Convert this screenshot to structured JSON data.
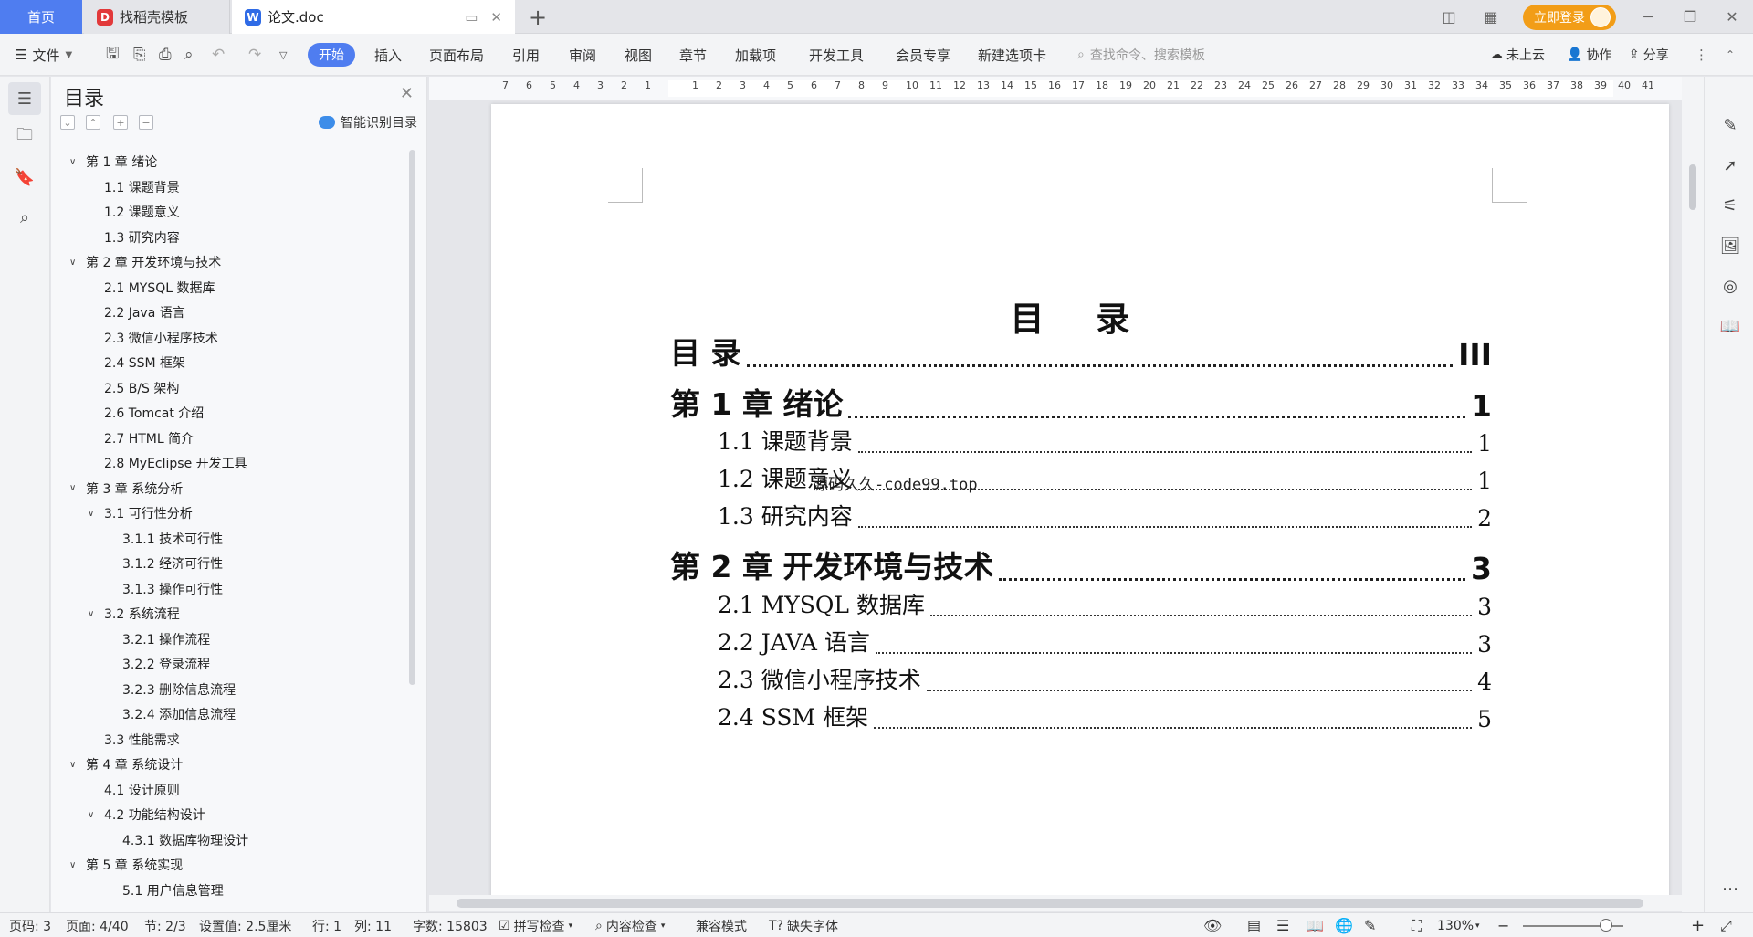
{
  "tabs": {
    "home": "首页",
    "template": "找稻壳模板",
    "doc": "论文.doc"
  },
  "window": {
    "login": "立即登录"
  },
  "ribbon": {
    "file": "文件",
    "menus": [
      "开始",
      "插入",
      "页面布局",
      "引用",
      "审阅",
      "视图",
      "章节",
      "加载项",
      "开发工具",
      "会员专享",
      "新建选项卡"
    ],
    "search_placeholder": "查找命令、搜索模板",
    "cloud": "未上云",
    "collab": "协作",
    "share": "分享"
  },
  "toc_pane": {
    "title": "目录",
    "smart": "智能识别目录",
    "items": [
      {
        "label": "第 1 章  绪论",
        "level": 1,
        "expand": true
      },
      {
        "label": "1.1  课题背景",
        "level": 2
      },
      {
        "label": "1.2  课题意义",
        "level": 2
      },
      {
        "label": "1.3  研究内容",
        "level": 2
      },
      {
        "label": "第 2 章  开发环境与技术",
        "level": 1,
        "expand": true
      },
      {
        "label": "2.1 MYSQL 数据库",
        "level": 2
      },
      {
        "label": "2.2 Java 语言",
        "level": 2
      },
      {
        "label": "2.3  微信小程序技术",
        "level": 2
      },
      {
        "label": "2.4 SSM 框架",
        "level": 2
      },
      {
        "label": "2.5 B/S 架构",
        "level": 2
      },
      {
        "label": "2.6 Tomcat  介绍",
        "level": 2
      },
      {
        "label": "2.7 HTML 简介",
        "level": 2
      },
      {
        "label": "2.8 MyEclipse 开发工具",
        "level": 2
      },
      {
        "label": "第 3 章  系统分析",
        "level": 1,
        "expand": true
      },
      {
        "label": "3.1  可行性分析",
        "level": 2,
        "expand": true
      },
      {
        "label": "3.1.1  技术可行性",
        "level": 3
      },
      {
        "label": "3.1.2  经济可行性",
        "level": 3
      },
      {
        "label": "3.1.3  操作可行性",
        "level": 3
      },
      {
        "label": "3.2  系统流程",
        "level": 2,
        "expand": true
      },
      {
        "label": "3.2.1  操作流程",
        "level": 3
      },
      {
        "label": "3.2.2  登录流程",
        "level": 3
      },
      {
        "label": "3.2.3  删除信息流程",
        "level": 3
      },
      {
        "label": "3.2.4  添加信息流程",
        "level": 3
      },
      {
        "label": "3.3  性能需求",
        "level": 2
      },
      {
        "label": "第 4 章  系统设计",
        "level": 1,
        "expand": true
      },
      {
        "label": "4.1  设计原则",
        "level": 2
      },
      {
        "label": "4.2  功能结构设计",
        "level": 2,
        "expand": true
      },
      {
        "label": "4.3.1  数据库物理设计",
        "level": 3
      },
      {
        "label": "第 5 章  系统实现",
        "level": 1,
        "expand": true
      },
      {
        "label": "5.1 用户信息管理",
        "level": 3
      }
    ]
  },
  "ruler": {
    "numbers": [
      "7",
      "6",
      "5",
      "4",
      "3",
      "2",
      "1",
      "",
      "1",
      "2",
      "3",
      "4",
      "5",
      "6",
      "7",
      "8",
      "9",
      "10",
      "11",
      "12",
      "13",
      "14",
      "15",
      "16",
      "17",
      "18",
      "19",
      "20",
      "21",
      "22",
      "23",
      "24",
      "25",
      "26",
      "27",
      "28",
      "29",
      "30",
      "31",
      "32",
      "33",
      "34",
      "35",
      "36",
      "37",
      "38",
      "39",
      "40",
      "41"
    ]
  },
  "document": {
    "heading": "目 录",
    "watermark": "源码久久-code99.top",
    "entries": [
      {
        "title": "目    录",
        "page": "III",
        "level": 1
      },
      {
        "title": "第 1 章  绪论",
        "page": "1",
        "level": 1
      },
      {
        "title": "1.1  课题背景",
        "page": "1",
        "level": 2
      },
      {
        "title": "1.2  课题意义",
        "page": "1",
        "level": 2
      },
      {
        "title": "1.3  研究内容",
        "page": "2",
        "level": 2
      },
      {
        "title": "第 2 章  开发环境与技术",
        "page": "3",
        "level": 1
      },
      {
        "title": "2.1 MYSQL  数据库",
        "page": "3",
        "level": 2
      },
      {
        "title": "2.2 JAVA 语言",
        "page": "3",
        "level": 2
      },
      {
        "title": "2.3  微信小程序技术",
        "page": "4",
        "level": 2
      },
      {
        "title": "2.4 SSM  框架",
        "page": "5",
        "level": 2
      }
    ]
  },
  "status": {
    "page_code": "页码: 3",
    "page": "页面: 4/40",
    "section": "节: 2/3",
    "setting": "设置值: 2.5厘米",
    "row": "行: 1",
    "col": "列: 11",
    "words": "字数: 15803",
    "spell": "拼写检查",
    "content_check": "内容检查",
    "compat": "兼容模式",
    "missing_font": "缺失字体",
    "zoom": "130%"
  }
}
